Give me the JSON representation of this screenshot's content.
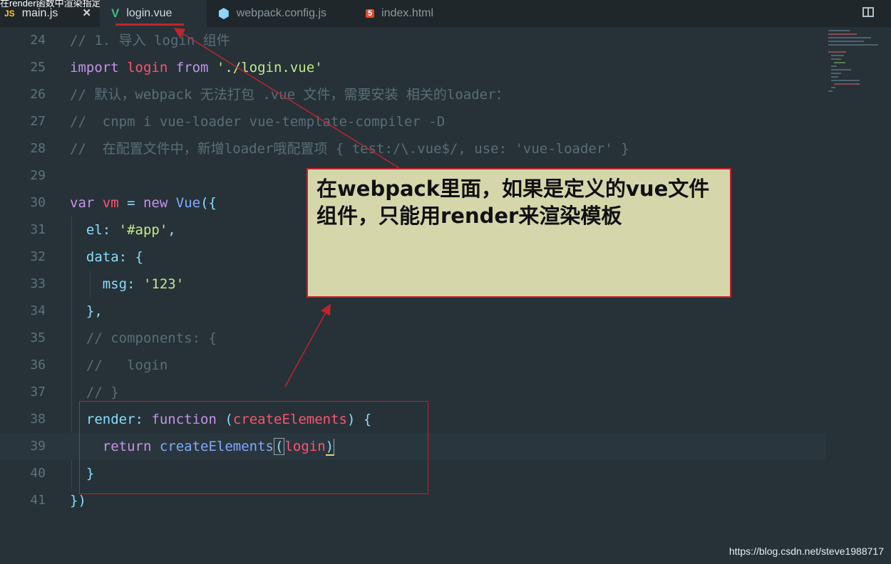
{
  "caption": "在render函数中渲染指定的组件到容器中",
  "tabs": [
    {
      "icon": "JS",
      "label": "main.js",
      "close": "✕"
    },
    {
      "icon": "V",
      "label": "login.vue"
    },
    {
      "icon": "⬢",
      "label": "webpack.config.js"
    },
    {
      "icon": "5",
      "label": "index.html"
    }
  ],
  "colors": {
    "accent": "#c0242b",
    "note_bg": "#d5d6aa",
    "editor_bg": "#263238"
  },
  "lines": [
    {
      "num": "24",
      "t": [
        {
          "c": "cm",
          "v": "// 1. 导入 login 组件"
        }
      ]
    },
    {
      "num": "25",
      "t": [
        {
          "c": "kw",
          "v": "import "
        },
        {
          "c": "var",
          "v": "login "
        },
        {
          "c": "kw",
          "v": "from "
        },
        {
          "c": "str",
          "v": "'./login.vue'"
        }
      ]
    },
    {
      "num": "26",
      "t": [
        {
          "c": "cm",
          "v": "// 默认，webpack 无法打包 .vue 文件，需要安装 相关的loader："
        }
      ]
    },
    {
      "num": "27",
      "t": [
        {
          "c": "cm",
          "v": "//  cnpm i vue-loader vue-template-compiler -D"
        }
      ]
    },
    {
      "num": "28",
      "t": [
        {
          "c": "cm",
          "v": "//  在配置文件中，新增loader哦配置项 { test:/\\.vue$/, use: 'vue-loader' }"
        }
      ]
    },
    {
      "num": "29",
      "t": []
    },
    {
      "num": "30",
      "t": [
        {
          "c": "kw",
          "v": "var "
        },
        {
          "c": "vm",
          "v": "vm "
        },
        {
          "c": "pn",
          "v": "= "
        },
        {
          "c": "kw",
          "v": "new "
        },
        {
          "c": "fn",
          "v": "Vue"
        },
        {
          "c": "pn",
          "v": "({"
        }
      ]
    },
    {
      "num": "31",
      "t": [
        {
          "c": "prop",
          "v": "  el"
        },
        {
          "c": "pn",
          "v": ": "
        },
        {
          "c": "str",
          "v": "'#app'"
        },
        {
          "c": "pn",
          "v": ","
        }
      ]
    },
    {
      "num": "32",
      "t": [
        {
          "c": "prop",
          "v": "  data"
        },
        {
          "c": "pn",
          "v": ": {"
        }
      ]
    },
    {
      "num": "33",
      "t": [
        {
          "c": "prop",
          "v": "    msg"
        },
        {
          "c": "pn",
          "v": ": "
        },
        {
          "c": "str",
          "v": "'123'"
        }
      ]
    },
    {
      "num": "34",
      "t": [
        {
          "c": "pn",
          "v": "  },"
        }
      ]
    },
    {
      "num": "35",
      "t": [
        {
          "c": "cm",
          "v": "  // components: {"
        }
      ]
    },
    {
      "num": "36",
      "t": [
        {
          "c": "cm",
          "v": "  //   login"
        }
      ]
    },
    {
      "num": "37",
      "t": [
        {
          "c": "cm",
          "v": "  // }"
        }
      ]
    },
    {
      "num": "38",
      "t": [
        {
          "c": "prop",
          "v": "  render"
        },
        {
          "c": "pn",
          "v": ": "
        },
        {
          "c": "kw",
          "v": "function "
        },
        {
          "c": "pn",
          "v": "("
        },
        {
          "c": "var",
          "v": "createElements"
        },
        {
          "c": "pn",
          "v": ") {"
        }
      ]
    },
    {
      "num": "39",
      "t": [
        {
          "c": "kw",
          "v": "    return "
        },
        {
          "c": "fn",
          "v": "createElements"
        },
        {
          "c": "pn brk",
          "v": "("
        },
        {
          "c": "var",
          "v": "login"
        },
        {
          "c": "pn brk2",
          "v": ")"
        }
      ]
    },
    {
      "num": "40",
      "t": [
        {
          "c": "pn",
          "v": "  }"
        }
      ]
    },
    {
      "num": "41",
      "t": [
        {
          "c": "pn",
          "v": "})"
        }
      ]
    }
  ],
  "callout": "在webpack里面，如果是定义的vue文件组件，只能用render来渲染模板",
  "watermark": "https://blog.csdn.net/steve1988717"
}
